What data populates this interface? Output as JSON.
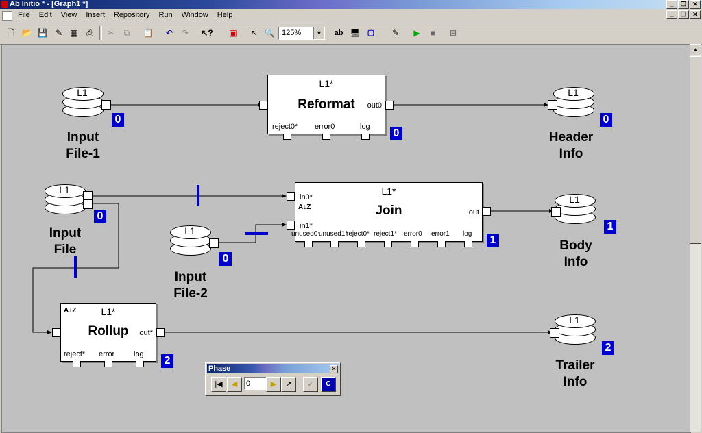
{
  "window": {
    "title": "Ab Initio * - [Graph1 *]"
  },
  "menu": [
    "File",
    "Edit",
    "View",
    "Insert",
    "Repository",
    "Run",
    "Window",
    "Help"
  ],
  "toolbar": {
    "icons": [
      "new-icon",
      "open-icon",
      "save-icon",
      "check-icon",
      "grid-icon",
      "print-icon",
      "cut-icon",
      "copy-icon",
      "paste-icon",
      "undo-icon",
      "redo-icon",
      "help-icon",
      "component-icon",
      "select-icon",
      "zoom-icon"
    ],
    "zoom_value": "125%",
    "right_icons": [
      "ab-text-icon",
      "monitor-icon",
      "phase-0-icon",
      "edit-icon",
      "run-icon",
      "stop-icon",
      "settings-icon"
    ]
  },
  "graph": {
    "files": {
      "input_file_1": {
        "layout": "L1",
        "name_line1": "Input",
        "name_line2": "File-1",
        "phase": "0"
      },
      "input_file": {
        "layout": "L1",
        "name_line1": "Input",
        "name_line2": "File",
        "phase": "0"
      },
      "input_file_2": {
        "layout": "L1",
        "name_line1": "Input",
        "name_line2": "File-2",
        "phase": "0"
      },
      "header_info": {
        "layout": "L1",
        "name_line1": "Header",
        "name_line2": "Info",
        "phase": "0"
      },
      "body_info": {
        "layout": "L1",
        "name_line1": "Body",
        "name_line2": "Info",
        "phase": "1"
      },
      "trailer_info": {
        "layout": "L1",
        "name_line1": "Trailer",
        "name_line2": "Info",
        "phase": "2"
      }
    },
    "components": {
      "reformat": {
        "layout": "L1*",
        "name": "Reformat",
        "out_port": "out0",
        "bottom_ports": [
          "reject0*",
          "error0",
          "log"
        ],
        "phase": "0"
      },
      "join": {
        "layout": "L1*",
        "name": "Join",
        "in_ports": [
          "in0*",
          "in1*"
        ],
        "out_port": "out",
        "bottom_ports": [
          "unused0*",
          "unused1*",
          "reject0*",
          "reject1*",
          "error0",
          "error1",
          "log"
        ],
        "phase": "1"
      },
      "rollup": {
        "layout": "L1*",
        "name": "Rollup",
        "out_port": "out*",
        "bottom_ports": [
          "reject*",
          "error",
          "log"
        ],
        "phase": "2"
      }
    }
  },
  "phase_toolbar": {
    "title": "Phase",
    "value": "0"
  }
}
